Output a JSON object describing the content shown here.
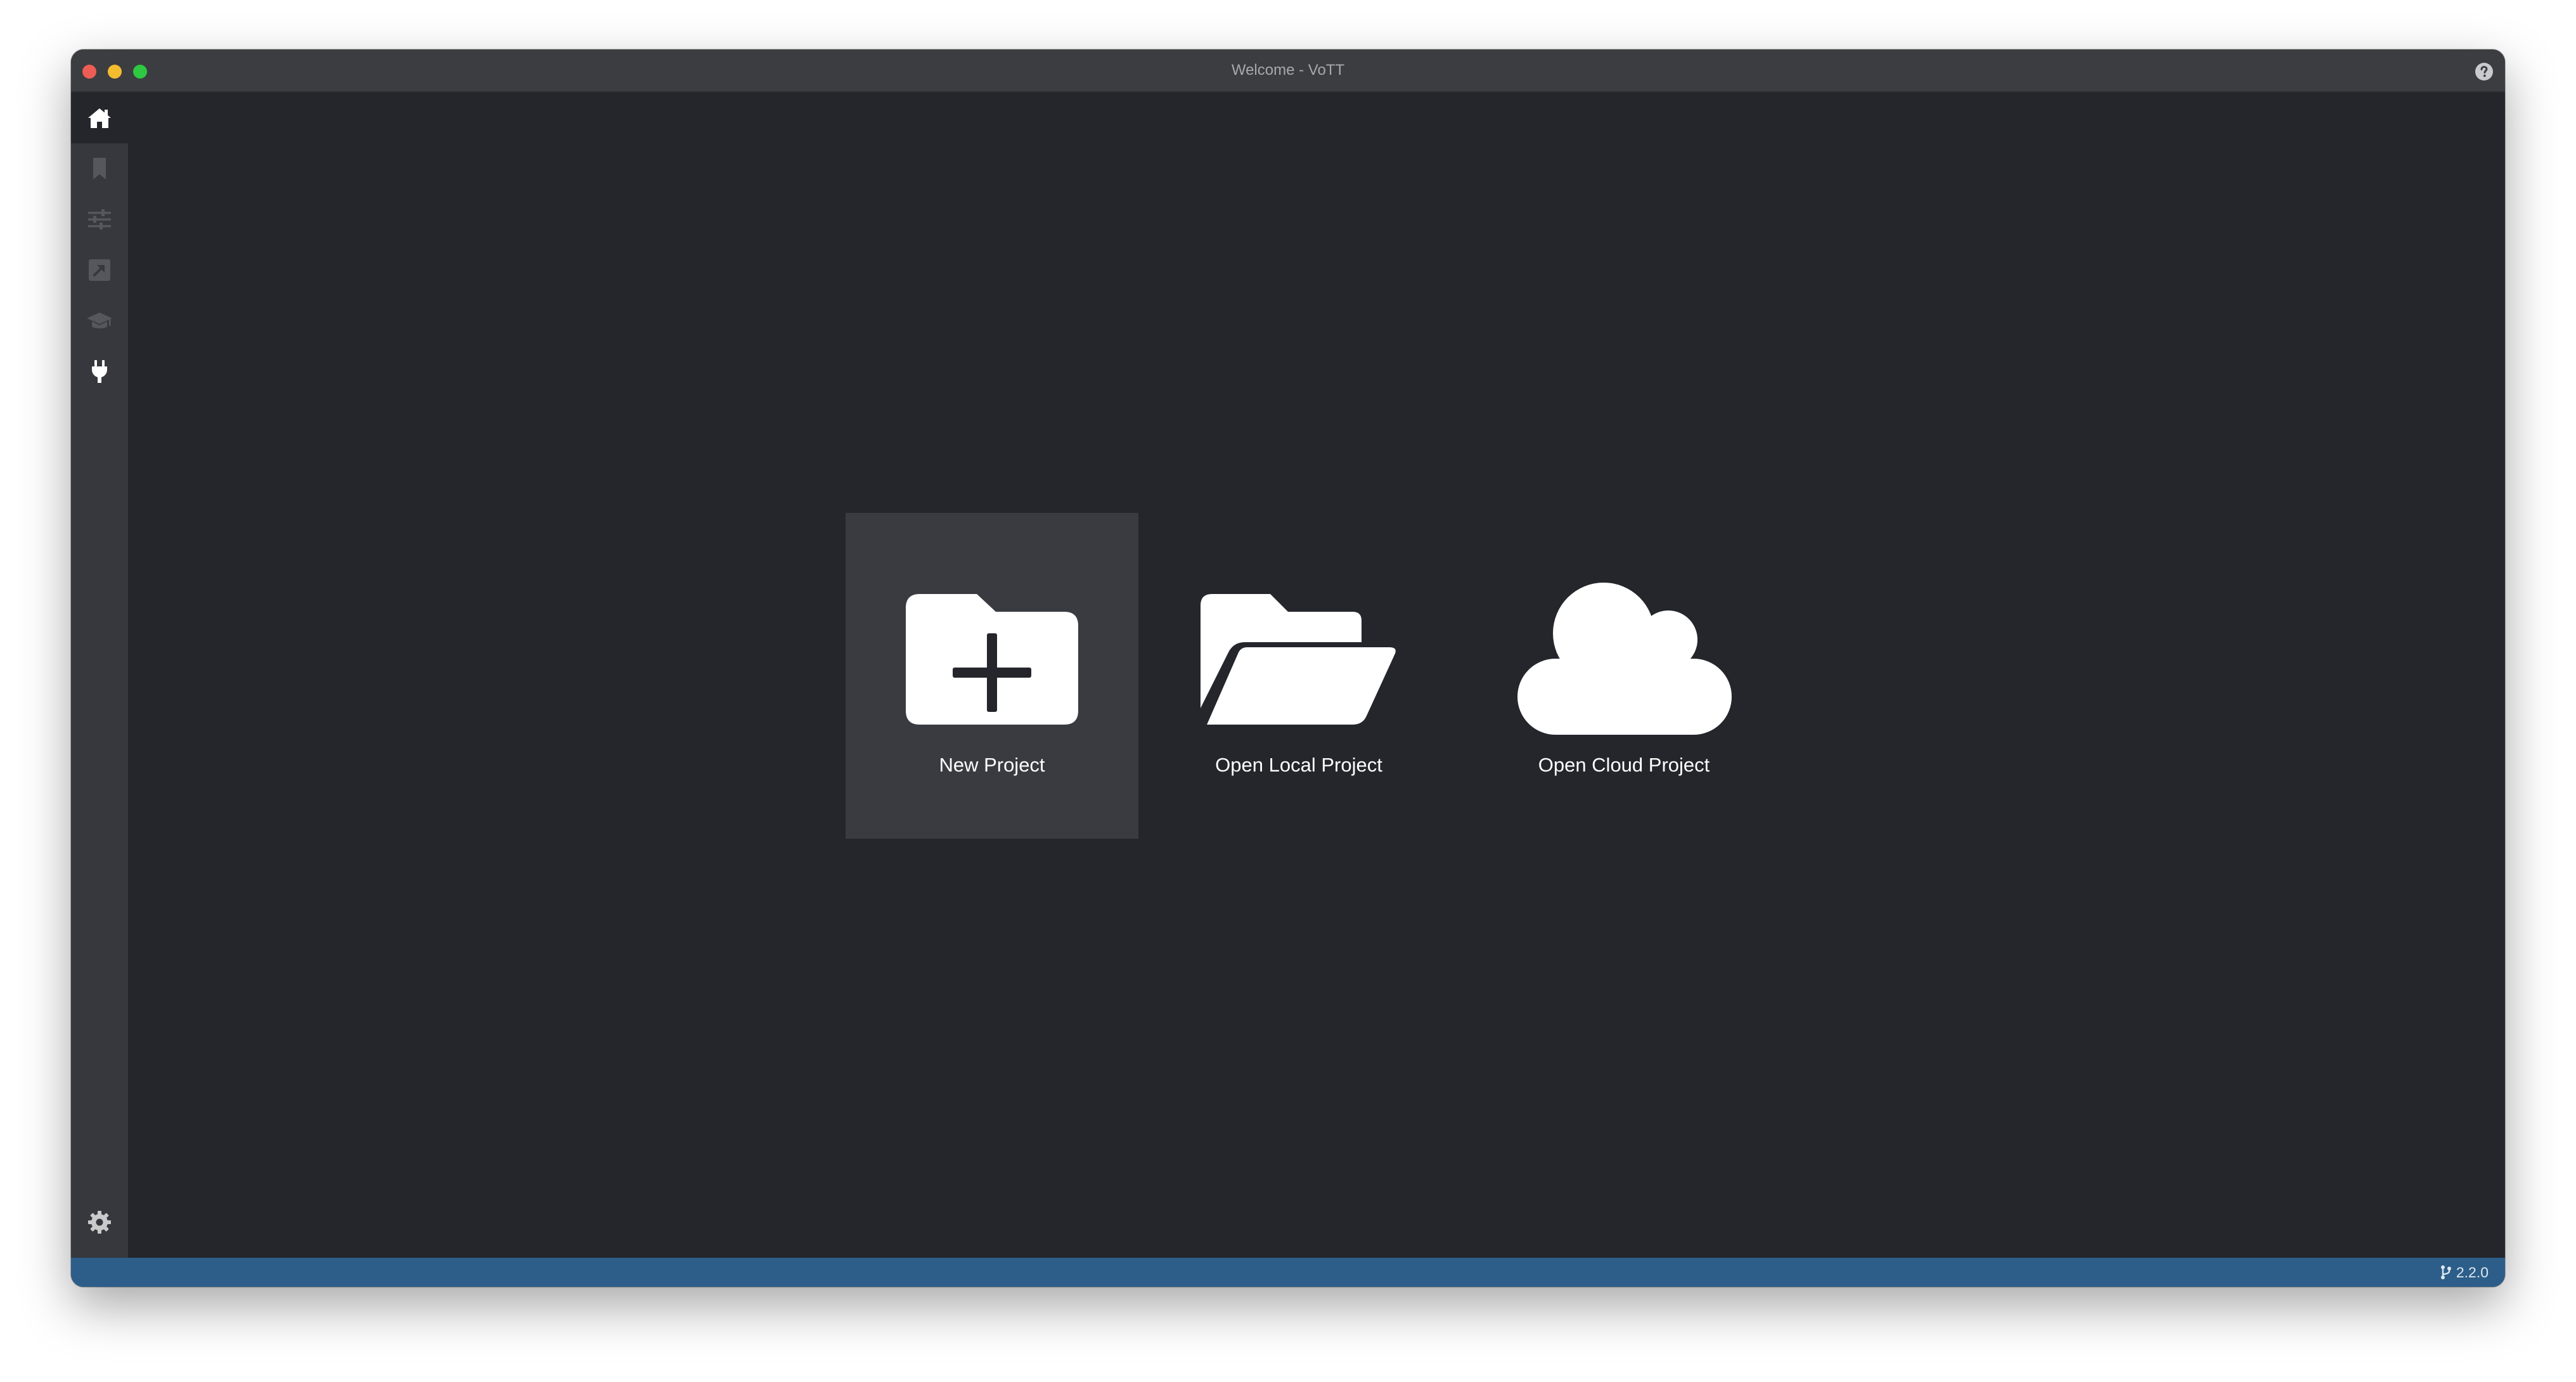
{
  "window": {
    "title": "Welcome - VoTT"
  },
  "sidebar": {
    "items": [
      {
        "name": "home-icon",
        "active": true
      },
      {
        "name": "bookmark-icon",
        "active": false
      },
      {
        "name": "sliders-icon",
        "active": false
      },
      {
        "name": "export-icon",
        "active": false
      },
      {
        "name": "graduation-cap-icon",
        "active": false
      },
      {
        "name": "plug-icon",
        "active": false
      }
    ],
    "settings_icon": "gear-icon"
  },
  "main": {
    "actions": [
      {
        "label": "New Project",
        "icon": "folder-plus-icon",
        "selected": true
      },
      {
        "label": "Open Local Project",
        "icon": "folder-open-icon",
        "selected": false
      },
      {
        "label": "Open Cloud Project",
        "icon": "cloud-icon",
        "selected": false
      }
    ]
  },
  "statusbar": {
    "version": "2.2.0",
    "version_icon": "code-branch-icon"
  },
  "colors": {
    "background": "#24262b",
    "sidebar": "#36383d",
    "titlebar": "#3c3d40",
    "statusbar": "#2c5e89",
    "tile_selected": "#393b40"
  }
}
